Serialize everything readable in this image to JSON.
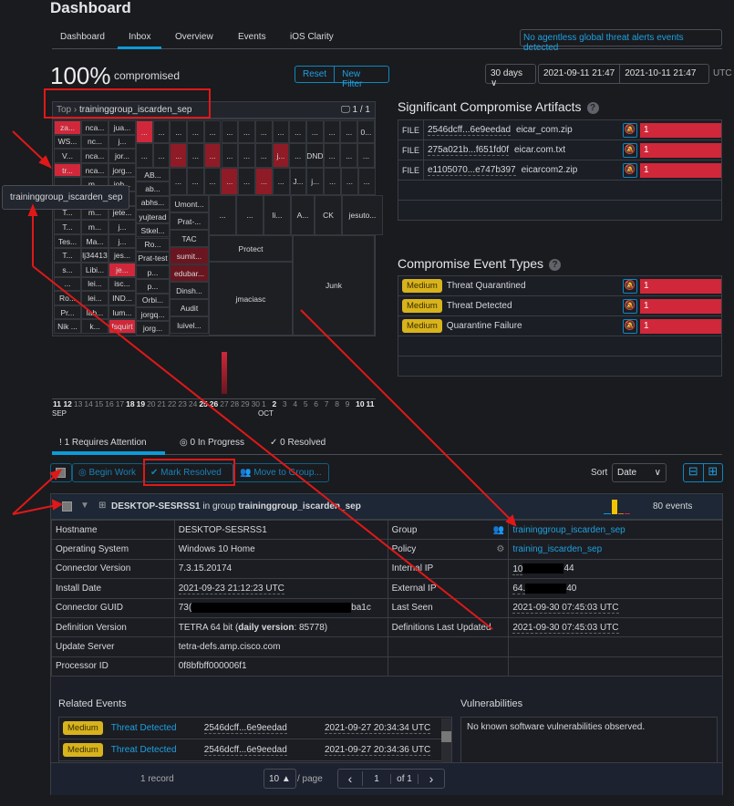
{
  "header": {
    "title": "Dashboard",
    "tabs": [
      "Dashboard",
      "Inbox",
      "Overview",
      "Events",
      "iOS Clarity"
    ],
    "active_tab": "Inbox",
    "alert": "No agentless global threat alerts events detected"
  },
  "summary": {
    "percent": "100%",
    "label": "compromised",
    "reset": "Reset",
    "new_filter": "New Filter",
    "range": "30 days",
    "range_caret": "∨",
    "start": "2021-09-11 21:47",
    "end": "2021-10-11 21:47",
    "tz": "UTC"
  },
  "treemap": {
    "crumb_root": "Top",
    "crumb_sep": "›",
    "crumb_group": "traininggroup_iscarden_sep",
    "computers": "1 / 1",
    "tooltip": "traininggroup_iscarden_sep",
    "left_rows": [
      [
        "za...",
        "nca...",
        "jua..."
      ],
      [
        "WS...",
        "nc...",
        "j..."
      ],
      [
        "V...",
        "nca...",
        "jor..."
      ],
      [
        "tr...",
        "nca...",
        "jorg..."
      ],
      [
        "...",
        "m...",
        "job..."
      ],
      [
        "...",
        "...",
        "..."
      ],
      [
        "T...",
        "m...",
        "jete..."
      ],
      [
        "T...",
        "m...",
        "j..."
      ],
      [
        "Tes...",
        "Ma...",
        "j..."
      ],
      [
        "T...",
        "lj34413",
        "jes..."
      ],
      [
        "s...",
        "Libi...",
        "je..."
      ],
      [
        "...",
        "lei...",
        "isc..."
      ],
      [
        "Ro...",
        "lei...",
        "IND..."
      ],
      [
        "Pr...",
        "lab...",
        "lum..."
      ],
      [
        "Nik ...",
        "k...",
        "fsquirt"
      ]
    ],
    "left_red": [
      "0-0",
      "3-0",
      "10-2",
      "14-2"
    ],
    "row1": [
      "...",
      "...",
      "...",
      "...",
      "...",
      "...",
      "...",
      "...",
      "...",
      "...",
      "...",
      "...",
      "...",
      "0..."
    ],
    "row1_red": [
      0
    ],
    "row2": [
      "...",
      "...",
      "...",
      "...",
      "...",
      "...",
      "...",
      "...",
      "j...",
      "...",
      "DND",
      "...",
      "...",
      "..."
    ],
    "row2_red": [
      2,
      4,
      8
    ],
    "row3": [
      "...",
      "...",
      "...",
      "...",
      "...",
      "...",
      "...",
      "J...",
      "j...",
      "...",
      "...",
      "..."
    ],
    "row3_red": [
      3,
      5
    ],
    "col_a": [
      "AB...",
      "ab...",
      "abhs...",
      "yujterad",
      "Stkel...",
      "Ro...",
      "Prat-test",
      "p...",
      "p...",
      "Orbi...",
      "jorgq...",
      "jorg..."
    ],
    "col_b": [
      "Umont...",
      "Prat-...",
      "TAC",
      "sumit...",
      "edubar...",
      "Dinsh...",
      "Audit",
      "luivel..."
    ],
    "col_b_dark": [
      3,
      4
    ],
    "small": [
      "...",
      "...",
      "li...",
      "A...",
      "CK",
      "jesuto..."
    ],
    "big": [
      "Protect",
      "jmaciasc",
      "Junk"
    ]
  },
  "timeline": {
    "ticks": [
      "11",
      "12",
      "13",
      "14",
      "15",
      "16",
      "17",
      "18",
      "19",
      "20",
      "21",
      "22",
      "23",
      "24",
      "25",
      "26",
      "27",
      "28",
      "29",
      "30",
      "1",
      "2",
      "3",
      "4",
      "5",
      "6",
      "7",
      "8",
      "9",
      "10",
      "11"
    ],
    "bold": [
      "11",
      "12",
      "18",
      "19",
      "25",
      "26",
      "2",
      "9",
      "10"
    ],
    "month1": "SEP",
    "month2": "OCT",
    "event_day_index": 16
  },
  "artifacts": {
    "title": "Significant Compromise Artifacts",
    "help": "?",
    "rows": [
      {
        "type": "FILE",
        "hash": "2546dcff...6e9eedad",
        "name": "eicar_com.zip",
        "count": "1"
      },
      {
        "type": "FILE",
        "hash": "275a021b...f651fd0f",
        "name": "eicar.com.txt",
        "count": "1"
      },
      {
        "type": "FILE",
        "hash": "e1105070...e747b397",
        "name": "eicarcom2.zip",
        "count": "1"
      }
    ]
  },
  "event_types": {
    "title": "Compromise Event Types",
    "help": "?",
    "rows": [
      {
        "severity": "Medium",
        "name": "Threat Quarantined",
        "count": "1"
      },
      {
        "severity": "Medium",
        "name": "Threat Detected",
        "count": "1"
      },
      {
        "severity": "Medium",
        "name": "Quarantine Failure",
        "count": "1"
      }
    ]
  },
  "inbox_tabs": [
    {
      "icon": "!",
      "label": "1 Requires Attention"
    },
    {
      "icon": "◎",
      "label": "0 In Progress"
    },
    {
      "icon": "✓",
      "label": "0 Resolved"
    }
  ],
  "toolbar": {
    "begin": "Begin Work",
    "resolve": "Mark Resolved",
    "move": "Move to Group...",
    "sort_label": "Sort",
    "sort_value": "Date",
    "collapse": "⊟",
    "expand": "⊞"
  },
  "device": {
    "name": "DESKTOP-SESRSS1",
    "in_group": "in group",
    "group": "traininggroup_iscarden_sep",
    "events": "80 events",
    "rows": [
      [
        "Hostname",
        "DESKTOP-SESRSS1",
        "Group",
        "traininggroup_iscarden_sep"
      ],
      [
        "Operating System",
        "Windows 10 Home",
        "Policy",
        "training_iscarden_sep"
      ],
      [
        "Connector Version",
        "7.3.15.20174",
        "Internal IP",
        "10"
      ],
      [
        "Install Date",
        "2021-09-23 21:12:23 UTC",
        "External IP",
        "64."
      ],
      [
        "Connector GUID",
        "73(",
        "Last Seen",
        "2021-09-30 07:45:03 UTC"
      ],
      [
        "Definition Version",
        "TETRA 64 bit (",
        "Definitions Last Updated",
        "2021-09-30 07:45:03 UTC"
      ],
      [
        "Update Server",
        "tetra-defs.amp.cisco.com",
        "",
        ""
      ],
      [
        "Processor ID",
        "0f8bfbff000006f1",
        "",
        ""
      ]
    ],
    "internal_ip_tail": "44",
    "external_ip_tail": "40",
    "guid_tail": "ba1c",
    "daily_label": "daily version",
    "daily_value": ": 85778)"
  },
  "related": {
    "title": "Related Events",
    "rows": [
      {
        "severity": "Medium",
        "type": "Threat Detected",
        "hash": "2546dcff...6e9eedad",
        "time": "2021-09-27 20:34:34 UTC"
      },
      {
        "severity": "Medium",
        "type": "Threat Detected",
        "hash": "2546dcff...6e9eedad",
        "time": "2021-09-27 20:34:36 UTC"
      }
    ]
  },
  "vulns": {
    "title": "Vulnerabilities",
    "text": "No known software vulnerabilities observed."
  },
  "pager": {
    "records": "1 record",
    "per_page": "10 ▲",
    "per_page_label": "/ page",
    "page": "1",
    "of": "of 1",
    "prev": "‹",
    "next": "›"
  },
  "colors": {
    "accent": "#0e9ad7",
    "threat": "#d0283a",
    "medium": "#d8b31c",
    "annotation": "#e01818"
  }
}
